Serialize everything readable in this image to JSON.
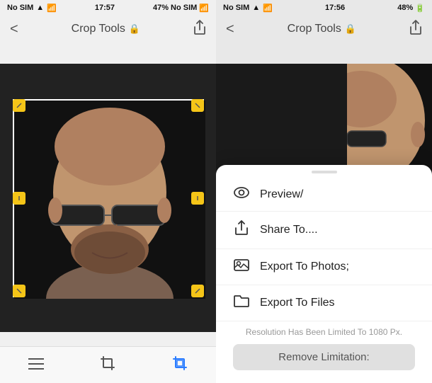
{
  "left_panel": {
    "status_bar": {
      "carrier": "No SIM",
      "signal": "wifi",
      "time": "17:57",
      "battery": "47%",
      "no_sim2": "No SIM"
    },
    "nav": {
      "title": "Crop Tools",
      "lock_icon": "🔒",
      "back_label": "<",
      "share_label": "⬆"
    },
    "toolbar": {
      "menu_label": "☰",
      "crop_label": "crop",
      "crop_active_label": "crop-active"
    }
  },
  "right_panel": {
    "status_bar": {
      "carrier": "No SIM",
      "signal": "wifi",
      "time": "17:56",
      "battery": "48%"
    },
    "nav": {
      "title": "Crop Tools",
      "lock_icon": "🔒",
      "back_label": "<",
      "share_label": "⬆"
    },
    "action_sheet": {
      "items": [
        {
          "id": "preview",
          "icon": "👁",
          "label": "Preview/"
        },
        {
          "id": "share",
          "icon": "share",
          "label": "Share To...."
        },
        {
          "id": "export-photos",
          "icon": "photo",
          "label": "Export To Photos;"
        },
        {
          "id": "export-files",
          "icon": "folder",
          "label": "Export To Files"
        }
      ],
      "resolution_note": "Resolution Has Been Limited To 1080 Px.",
      "remove_limitation_label": "Remove Limitation:"
    },
    "toolbar": {
      "menu_label": "☰",
      "crop_label": "crop",
      "crop_active_label": "crop-active"
    }
  }
}
